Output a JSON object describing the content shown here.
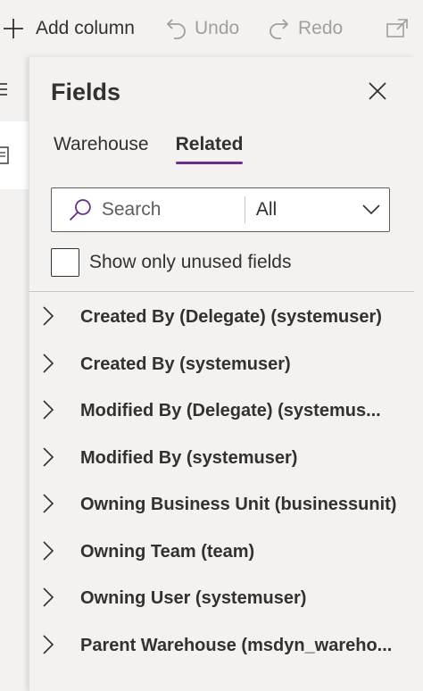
{
  "toolbar": {
    "add_column_label": "Add column",
    "undo_label": "Undo",
    "redo_label": "Redo"
  },
  "panel": {
    "title": "Fields",
    "tabs": [
      {
        "label": "Warehouse",
        "active": false
      },
      {
        "label": "Related",
        "active": true
      }
    ],
    "search": {
      "placeholder": "Search",
      "value": ""
    },
    "filter": {
      "selected": "All"
    },
    "unused_checkbox": {
      "label": "Show only unused fields",
      "checked": false
    },
    "fields": [
      {
        "label": "Created By (Delegate) (systemuser)"
      },
      {
        "label": "Created By (systemuser)"
      },
      {
        "label": "Modified By (Delegate) (systemus..."
      },
      {
        "label": "Modified By (systemuser)"
      },
      {
        "label": "Owning Business Unit (businessunit)"
      },
      {
        "label": "Owning Team (team)"
      },
      {
        "label": "Owning User (systemuser)"
      },
      {
        "label": "Parent Warehouse (msdyn_wareho..."
      }
    ]
  },
  "colors": {
    "accent": "#6b2e8a",
    "background": "#f3f2f1",
    "text": "#323130",
    "disabled": "#a19f9d"
  }
}
